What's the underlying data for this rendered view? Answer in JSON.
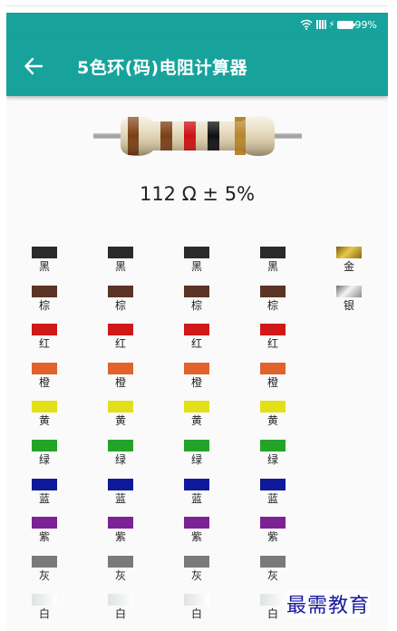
{
  "status": {
    "battery": "99%",
    "icons": [
      "wifi-icon",
      "signal-icon",
      "charging-icon",
      "battery-icon"
    ]
  },
  "header": {
    "title": "5色环(码)电阻计算器",
    "back_icon": "arrow-left-icon"
  },
  "resistor": {
    "body_color": "#e6dcc4",
    "bands": [
      "#7b3f16",
      "#7b3f16",
      "#cc1111",
      "#111111",
      "#b8862a"
    ]
  },
  "result": {
    "text": "112 Ω ± 5%"
  },
  "colors": {
    "black": {
      "label": "黑",
      "hex": "#2a2a2a"
    },
    "brown": {
      "label": "棕",
      "hex": "#5b3425"
    },
    "red": {
      "label": "红",
      "hex": "#d01818"
    },
    "orange": {
      "label": "橙",
      "hex": "#e0632c"
    },
    "yellow": {
      "label": "黄",
      "hex": "#e2e019"
    },
    "green": {
      "label": "绿",
      "hex": "#23a428"
    },
    "blue": {
      "label": "蓝",
      "hex": "#0f1a9a"
    },
    "purple": {
      "label": "紫",
      "hex": "#7d2294"
    },
    "gray": {
      "label": "灰",
      "hex": "#7a7a7a"
    },
    "white": {
      "label": "白",
      "hex": "#eef0f0"
    },
    "gold": {
      "label": "金",
      "hex": "#b18a1c"
    },
    "silver": {
      "label": "银",
      "hex": "#b8b8b8"
    }
  },
  "bands": [
    {
      "name": "band1",
      "options": [
        "black",
        "brown",
        "red",
        "orange",
        "yellow",
        "green",
        "blue",
        "purple",
        "gray",
        "white"
      ]
    },
    {
      "name": "band2",
      "options": [
        "black",
        "brown",
        "red",
        "orange",
        "yellow",
        "green",
        "blue",
        "purple",
        "gray",
        "white"
      ]
    },
    {
      "name": "band3",
      "options": [
        "black",
        "brown",
        "red",
        "orange",
        "yellow",
        "green",
        "blue",
        "purple",
        "gray",
        "white"
      ]
    },
    {
      "name": "multiplier",
      "options": [
        "black",
        "brown",
        "red",
        "orange",
        "yellow",
        "green",
        "blue",
        "purple",
        "gray",
        "white"
      ]
    },
    {
      "name": "tolerance",
      "options": [
        "gold",
        "silver"
      ]
    }
  ],
  "watermark": "最需教育"
}
